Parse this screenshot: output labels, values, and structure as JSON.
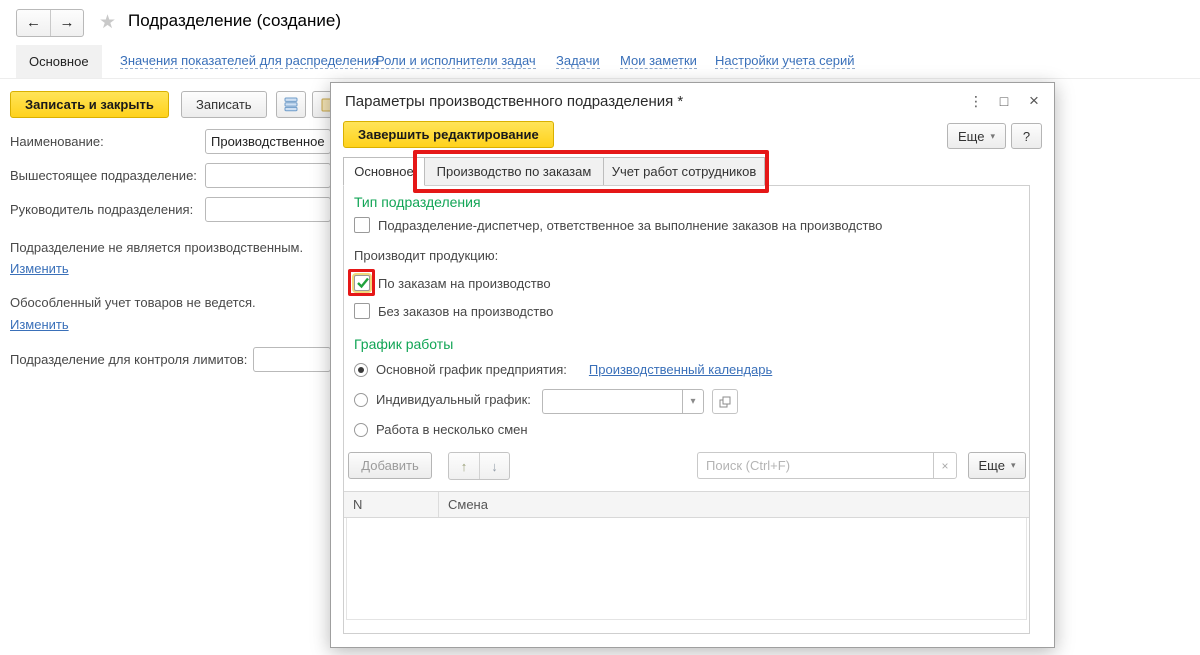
{
  "colors": {
    "accent_yellow": "#ffd21c",
    "green_heading": "#12a556",
    "link_blue": "#3a70b9",
    "annotation_red": "#e51717",
    "check_green": "#21a23c"
  },
  "icons": {
    "back": "←",
    "forward": "→",
    "star": "★",
    "kebab": "⋮",
    "maximize": "□",
    "close": "×",
    "caret": "▾",
    "clear": "×",
    "up": "↑",
    "down": "↓",
    "help": "?"
  },
  "window": {
    "title": "Подразделение (создание)",
    "nav": {
      "active": "Основное",
      "links": [
        "Значения показателей для распределения",
        "Роли и исполнители задач",
        "Задачи",
        "Мои заметки",
        "Настройки учета серий"
      ]
    },
    "toolbar": {
      "save_close": "Записать и закрыть",
      "save": "Записать"
    },
    "form": {
      "name_label": "Наименование:",
      "name_value": "Производственное",
      "parent_label": "Вышестоящее подразделение:",
      "parent_value": "",
      "manager_label": "Руководитель подразделения:",
      "manager_value": "",
      "not_production_text": "Подразделение не является производственным.",
      "change_link": "Изменить",
      "separate_accounting_text": "Обособленный учет товаров не ведется.",
      "change_link_2": "Изменить",
      "limits_label": "Подразделение для контроля лимитов:",
      "limits_value": ""
    }
  },
  "dialog": {
    "title": "Параметры производственного подразделения *",
    "finish_button": "Завершить редактирование",
    "more_button": "Еще",
    "help_button": "?",
    "tabs": [
      {
        "label": "Основное",
        "active": true
      },
      {
        "label": "Производство по заказам",
        "active": false
      },
      {
        "label": "Учет работ сотрудников",
        "active": false
      }
    ],
    "content": {
      "type_heading": "Тип подразделения",
      "dispatcher_label": "Подразделение-диспетчер, ответственное за выполнение заказов на производство",
      "dispatcher_checked": false,
      "produces_label": "Производит продукцию:",
      "by_orders_label": "По заказам на производство",
      "by_orders_checked": true,
      "without_orders_label": "Без заказов на производство",
      "without_orders_checked": false,
      "schedule_heading": "График работы",
      "main_schedule_label": "Основной график предприятия:",
      "calendar_link": "Производственный календарь",
      "individual_label": "Индивидуальный график:",
      "individual_value": "",
      "shifts_label": "Работа в несколько смен",
      "selected_schedule": "Основной график предприятия:"
    },
    "table_toolbar": {
      "add_button": "Добавить",
      "search_placeholder": "Поиск (Ctrl+F)",
      "more_button": "Еще"
    },
    "table": {
      "columns": [
        "N",
        "Смена"
      ],
      "rows": []
    }
  }
}
